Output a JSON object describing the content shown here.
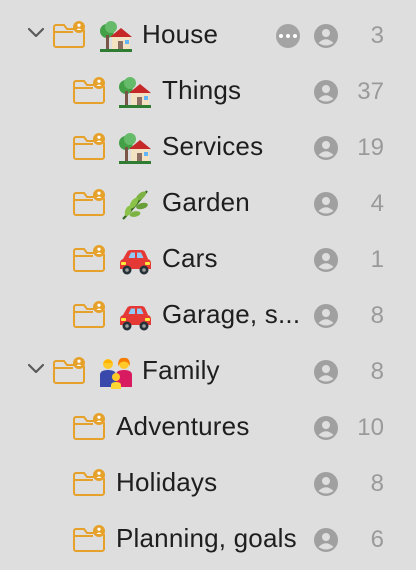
{
  "colors": {
    "background": "#dedede",
    "folder_stroke": "#e6a12a",
    "label": "#1e1e1e",
    "count": "#9a9a9a",
    "person_icon": "#a0a0a0"
  },
  "rows": [
    {
      "label": "House",
      "count": "3",
      "emoji": "house-with-garden",
      "expanded": true,
      "level": 0,
      "has_more": true
    },
    {
      "label": "Things",
      "count": "37",
      "emoji": "house-with-garden",
      "level": 1
    },
    {
      "label": "Services",
      "count": "19",
      "emoji": "house-with-garden",
      "level": 1
    },
    {
      "label": "Garden",
      "count": "4",
      "emoji": "herb",
      "level": 1
    },
    {
      "label": "Cars",
      "count": "1",
      "emoji": "automobile",
      "level": 1
    },
    {
      "label": "Garage, s...",
      "count": "8",
      "emoji": "automobile",
      "level": 1
    },
    {
      "label": "Family",
      "count": "8",
      "emoji": "family",
      "expanded": true,
      "level": 0
    },
    {
      "label": "Adventures",
      "count": "10",
      "emoji": "",
      "level": 1
    },
    {
      "label": "Holidays",
      "count": "8",
      "emoji": "",
      "level": 1
    },
    {
      "label": "Planning, goals",
      "count": "6",
      "emoji": "",
      "level": 1
    }
  ]
}
